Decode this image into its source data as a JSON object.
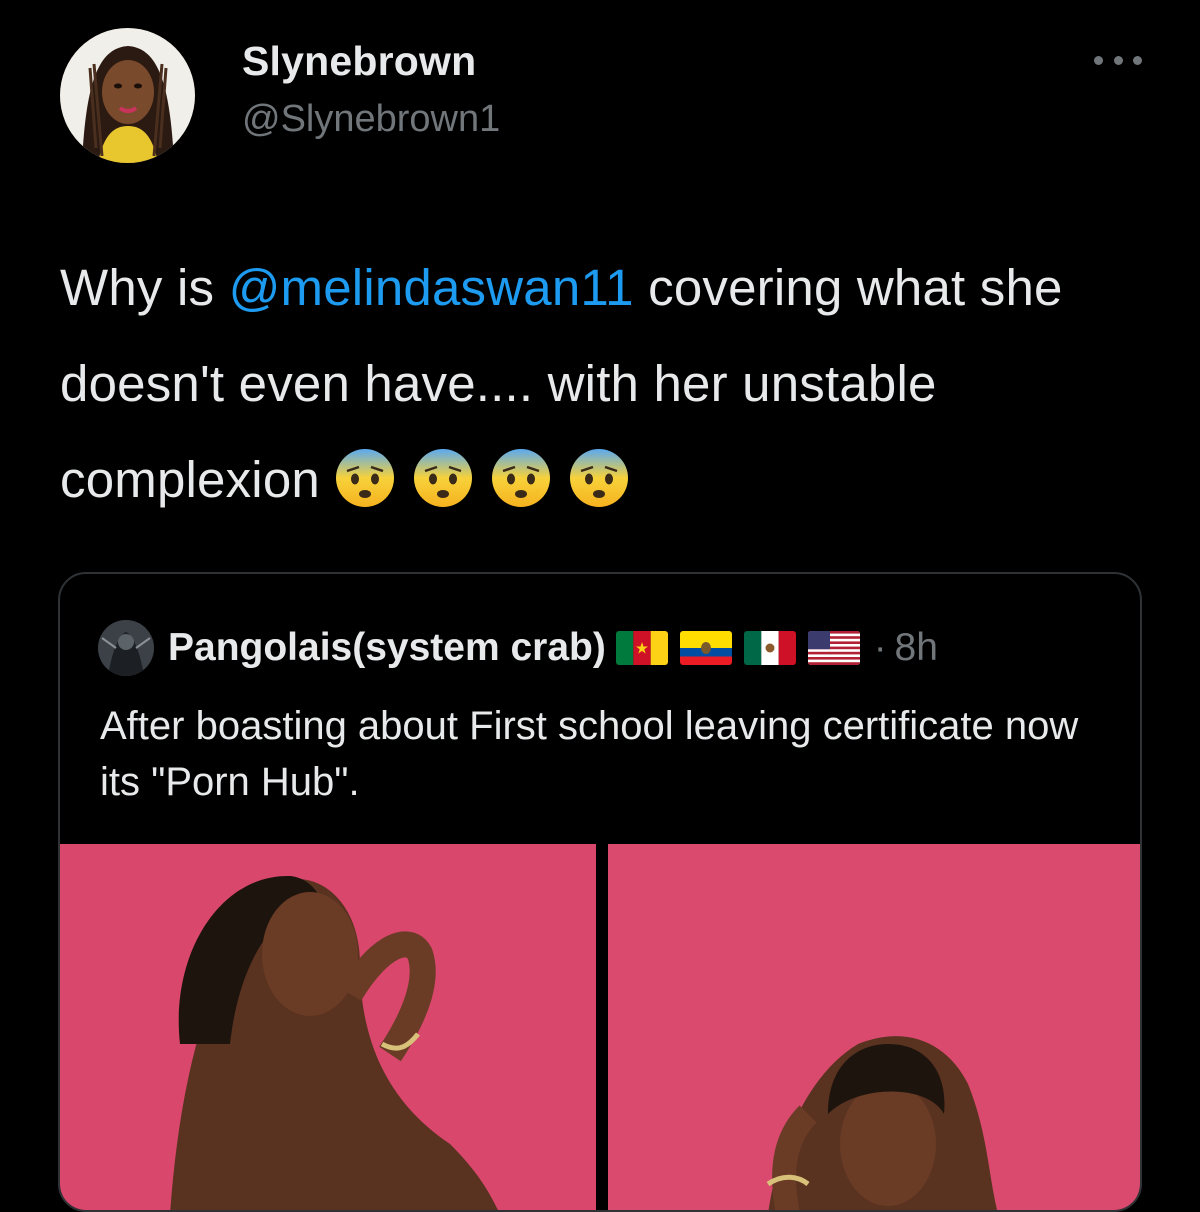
{
  "author": {
    "display_name": "Slynebrown",
    "handle": "@Slynebrown1"
  },
  "tweet": {
    "text_before": "Why is ",
    "mention": "@melindaswan11",
    "text_after": " covering what she doesn't even have.... with her unstable complexion",
    "emojis": [
      "fearful-face",
      "fearful-face",
      "fearful-face",
      "fearful-face"
    ]
  },
  "quoted_tweet": {
    "display_name": "Pangolais(system crab)",
    "flags": [
      "cameroon-flag",
      "ecuador-flag",
      "mexico-flag",
      "usa-flag"
    ],
    "dot": "·",
    "time": "8h",
    "text": "After boasting about First school leaving certificate now its \"Porn Hub\".",
    "media": [
      "photo-1",
      "photo-2"
    ]
  },
  "icons": {
    "more": "more-horizontal-icon"
  },
  "colors": {
    "background": "#000000",
    "text": "#e7e9ea",
    "secondary": "#71767b",
    "link": "#1d9bf0",
    "border": "#2f3336",
    "photo_background": "#d9476c"
  }
}
